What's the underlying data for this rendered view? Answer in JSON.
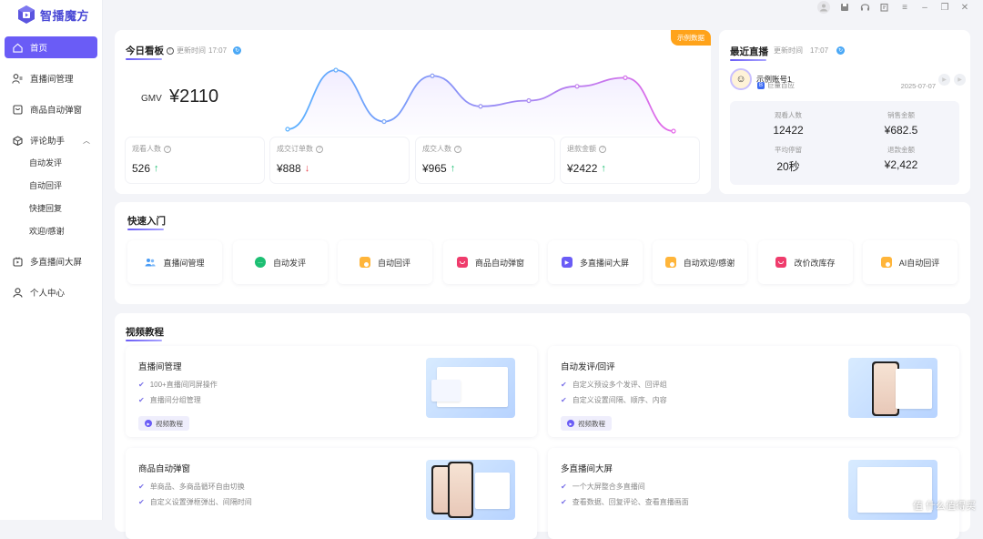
{
  "app": {
    "name": "智播魔方"
  },
  "sidebar": {
    "items": [
      {
        "label": "首页",
        "icon": "home-icon"
      },
      {
        "label": "直播间管理",
        "icon": "users-icon"
      },
      {
        "label": "商品自动弹窗",
        "icon": "box-icon"
      },
      {
        "label": "评论助手",
        "icon": "chat-icon"
      },
      {
        "label": "多直播间大屏",
        "icon": "screen-icon"
      },
      {
        "label": "个人中心",
        "icon": "user-icon"
      }
    ],
    "sub_items": [
      "自动发评",
      "自动回评",
      "快捷回复",
      "欢迎/感谢"
    ]
  },
  "today": {
    "title": "今日看板",
    "update_label": "更新时间",
    "update_time": "17:07",
    "badge": "示例数据",
    "gmv_label": "GMV",
    "gmv_value": "¥2110",
    "stats": [
      {
        "label": "观看人数",
        "value": "526",
        "trend": "up"
      },
      {
        "label": "成交订单数",
        "value": "¥888",
        "trend": "down"
      },
      {
        "label": "成交人数",
        "value": "¥965",
        "trend": "up"
      },
      {
        "label": "退款金额",
        "value": "¥2422",
        "trend": "up"
      }
    ],
    "trend_series": [
      10,
      72,
      18,
      66,
      34,
      40,
      55,
      64,
      8
    ]
  },
  "recent": {
    "title": "最近直播",
    "update_label": "更新时间",
    "update_time": "17:07",
    "account_name": "示例账号1",
    "platform": "巨量百应",
    "date": "2025-07-07",
    "stats": [
      {
        "label": "观看人数",
        "value": "12422"
      },
      {
        "label": "销售金额",
        "value": "¥682.5"
      },
      {
        "label": "平均停留",
        "value": "20秒"
      },
      {
        "label": "退款金额",
        "value": "¥2,422"
      }
    ]
  },
  "quick": {
    "title": "快速入门",
    "items": [
      {
        "label": "直播间管理",
        "icon": "users-icon",
        "color": "#4a9cf6"
      },
      {
        "label": "自动发评",
        "icon": "chat-bubble-icon",
        "color": "#1dbf73"
      },
      {
        "label": "自动回评",
        "icon": "reply-icon",
        "color": "#ffa31a"
      },
      {
        "label": "商品自动弹窗",
        "icon": "bag-icon",
        "color": "#ef3c6c"
      },
      {
        "label": "多直播间大屏",
        "icon": "play-icon",
        "color": "#6a5cf6"
      },
      {
        "label": "自动欢迎/感谢",
        "icon": "welcome-icon",
        "color": "#ffa31a"
      },
      {
        "label": "改价改库存",
        "icon": "price-icon",
        "color": "#ef3c6c"
      },
      {
        "label": "AI自动回评",
        "icon": "ai-reply-icon",
        "color": "#ffa31a"
      }
    ]
  },
  "videos": {
    "title": "视频教程",
    "button_label": "视频教程",
    "items": [
      {
        "title": "直播间管理",
        "bullets": [
          "100+直播间同屏操作",
          "直播间分组管理"
        ]
      },
      {
        "title": "自动发评/回评",
        "bullets": [
          "自定义预设多个发评、回评组",
          "自定义设置间隔、顺序、内容"
        ]
      },
      {
        "title": "商品自动弹窗",
        "bullets": [
          "单商品、多商品循环自由切换",
          "自定义设置弹框弹出、间隔时间"
        ]
      },
      {
        "title": "多直播间大屏",
        "bullets": [
          "一个大屏整合多直播间",
          "查看数据、回复评论、查看直播画面"
        ]
      }
    ]
  },
  "watermark": "值 什么值得买"
}
